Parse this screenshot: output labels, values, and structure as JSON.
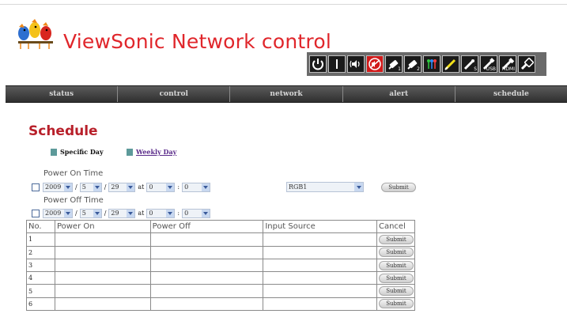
{
  "app": {
    "title": "ViewSonic Network control"
  },
  "toolbar": {
    "buttons": [
      {
        "icon": "power-icon"
      },
      {
        "icon": "input-bar-icon"
      },
      {
        "icon": "volume-icon"
      },
      {
        "icon": "mute-icon"
      },
      {
        "icon": "connector-1-icon",
        "sub": "1"
      },
      {
        "icon": "connector-2-icon",
        "sub": "2"
      },
      {
        "icon": "component-icon"
      },
      {
        "icon": "video-icon"
      },
      {
        "icon": "svideo-icon",
        "sub": "S"
      },
      {
        "icon": "usb-icon",
        "sub": "USB"
      },
      {
        "icon": "hdmi-icon",
        "sub": "HDMI"
      },
      {
        "icon": "vga-icon"
      }
    ]
  },
  "nav": {
    "items": [
      "status",
      "control",
      "network",
      "alert",
      "schedule"
    ]
  },
  "schedule": {
    "title": "Schedule",
    "modes": [
      "Specific Day",
      "Weekly Day"
    ],
    "power_on_label": "Power On Time",
    "power_off_label": "Power Off Time",
    "power_on": {
      "year": "2009",
      "month": "5",
      "day": "29",
      "at": "at",
      "hour": "0",
      "minute": "0"
    },
    "power_off": {
      "year": "2009",
      "month": "5",
      "day": "29",
      "at": "at",
      "hour": "0",
      "minute": "0"
    },
    "date_sep": "/",
    "time_sep": ":",
    "input_source": "RGB1",
    "submit_label": "Submit"
  },
  "table": {
    "headers": [
      "No.",
      "Power On",
      "Power Off",
      "Input Source",
      "Cancel"
    ],
    "rows": [
      {
        "no": "1",
        "on": "",
        "off": "",
        "src": "",
        "cancel": "Submit"
      },
      {
        "no": "2",
        "on": "",
        "off": "",
        "src": "",
        "cancel": "Submit"
      },
      {
        "no": "3",
        "on": "",
        "off": "",
        "src": "",
        "cancel": "Submit"
      },
      {
        "no": "4",
        "on": "",
        "off": "",
        "src": "",
        "cancel": "Submit"
      },
      {
        "no": "5",
        "on": "",
        "off": "",
        "src": "",
        "cancel": "Submit"
      },
      {
        "no": "6",
        "on": "",
        "off": "",
        "src": "",
        "cancel": "Submit"
      }
    ]
  },
  "colors": {
    "title_red": "#e0262b",
    "section_red": "#b8202a",
    "tab_square": "#5d9a9a"
  }
}
